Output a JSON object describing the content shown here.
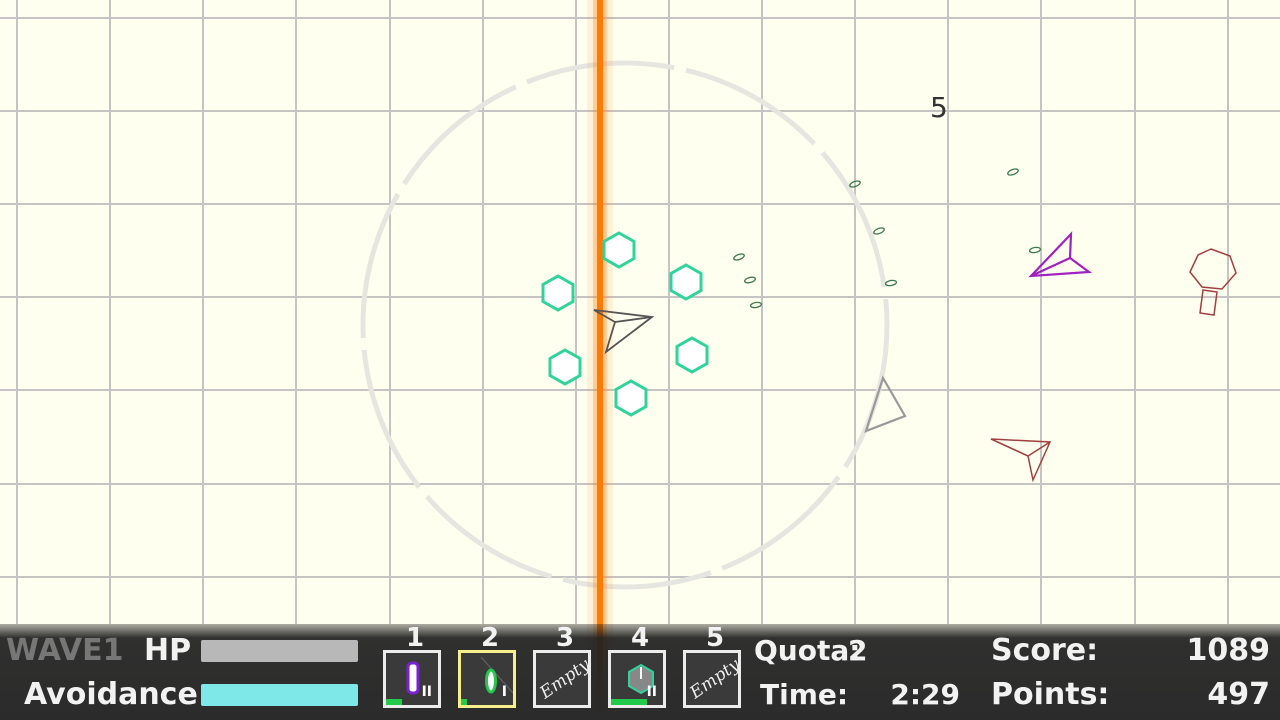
{
  "field": {
    "floating_number": "5",
    "laser_color": "#ff8a1a",
    "player_color": "#555555",
    "shield_color": "#2fd49a",
    "enemy_colors": [
      "#a020c0",
      "#a04040",
      "#888888"
    ],
    "icons": [
      "player-ship-icon",
      "shield-hexagon-icon",
      "enemy-ship-icon",
      "enemy-turret-icon",
      "bullet-icon",
      "laser-beam"
    ]
  },
  "hud": {
    "wave_label": "WAVE1",
    "hp_label": "HP",
    "hp_color": "#b8b8b8",
    "hp_fraction": 1.0,
    "avoidance_label": "Avoidance",
    "avoidance_color": "#7ee8e8",
    "avoidance_fraction": 1.0,
    "slots": [
      {
        "number": "1",
        "content": "",
        "icon": "purple-bullet-icon",
        "ammo_mark": "II",
        "ammo_fraction": 0.3,
        "selected": false
      },
      {
        "number": "2",
        "content": "",
        "icon": "green-seed-icon",
        "ammo_mark": "I",
        "ammo_fraction": 0.12,
        "selected": true
      },
      {
        "number": "3",
        "content": "Empty",
        "icon": "",
        "ammo_mark": "",
        "ammo_fraction": 0,
        "selected": false
      },
      {
        "number": "4",
        "content": "",
        "icon": "hexagon-shield-icon",
        "ammo_mark": "II",
        "ammo_fraction": 0.7,
        "selected": false
      },
      {
        "number": "5",
        "content": "Empty",
        "icon": "",
        "ammo_mark": "",
        "ammo_fraction": 0,
        "selected": false
      }
    ],
    "quota_label": "Quota:",
    "quota_value": "2",
    "time_label": "Time:",
    "time_value": "2:29",
    "score_label": "Score:",
    "score_value": "1089",
    "points_label": "Points:",
    "points_value": "497"
  }
}
